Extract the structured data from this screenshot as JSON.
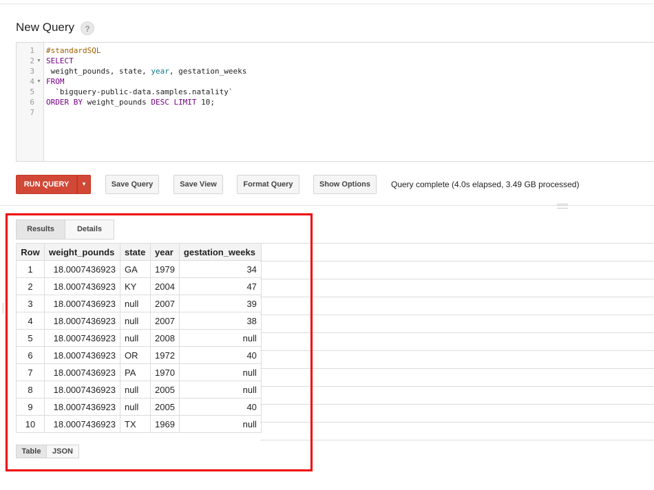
{
  "header": {
    "title": "New Query",
    "help_glyph": "?"
  },
  "editor": {
    "line_numbers": [
      "1",
      "2",
      "3",
      "4",
      "5",
      "6",
      "7"
    ],
    "lines": [
      [
        {
          "t": "#standardSQL",
          "c": "cm"
        }
      ],
      [
        {
          "t": "SELECT",
          "c": "kw"
        }
      ],
      [
        {
          "t": " weight_pounds, state, ",
          "c": ""
        },
        {
          "t": "year",
          "c": "fn"
        },
        {
          "t": ", gestation_weeks",
          "c": ""
        }
      ],
      [
        {
          "t": "FROM",
          "c": "kw"
        }
      ],
      [
        {
          "t": "  `bigquery-public-data.samples.natality`",
          "c": ""
        }
      ],
      [
        {
          "t": "ORDER BY",
          "c": "kw"
        },
        {
          "t": " weight_pounds ",
          "c": ""
        },
        {
          "t": "DESC LIMIT",
          "c": "kw"
        },
        {
          "t": " 10;",
          "c": ""
        }
      ],
      []
    ]
  },
  "toolbar": {
    "run_label": "RUN QUERY",
    "save_query_label": "Save Query",
    "save_view_label": "Save View",
    "format_query_label": "Format Query",
    "show_options_label": "Show Options",
    "status_text": "Query complete (4.0s elapsed, 3.49 GB processed)"
  },
  "results": {
    "tabs": [
      "Results",
      "Details"
    ],
    "columns": [
      "Row",
      "weight_pounds",
      "state",
      "year",
      "gestation_weeks"
    ],
    "rows": [
      [
        "1",
        "18.0007436923",
        "GA",
        "1979",
        "34"
      ],
      [
        "2",
        "18.0007436923",
        "KY",
        "2004",
        "47"
      ],
      [
        "3",
        "18.0007436923",
        "null",
        "2007",
        "39"
      ],
      [
        "4",
        "18.0007436923",
        "null",
        "2007",
        "38"
      ],
      [
        "5",
        "18.0007436923",
        "null",
        "2008",
        "null"
      ],
      [
        "6",
        "18.0007436923",
        "OR",
        "1972",
        "40"
      ],
      [
        "7",
        "18.0007436923",
        "PA",
        "1970",
        "null"
      ],
      [
        "8",
        "18.0007436923",
        "null",
        "2005",
        "null"
      ],
      [
        "9",
        "18.0007436923",
        "null",
        "2005",
        "40"
      ],
      [
        "10",
        "18.0007436923",
        "TX",
        "1969",
        "null"
      ]
    ],
    "view_tabs": [
      "Table",
      "JSON"
    ]
  },
  "colors": {
    "run_button": "#d14836",
    "highlight_box": "#ee0000",
    "keyword": "#770088",
    "comment": "#a05b00"
  }
}
